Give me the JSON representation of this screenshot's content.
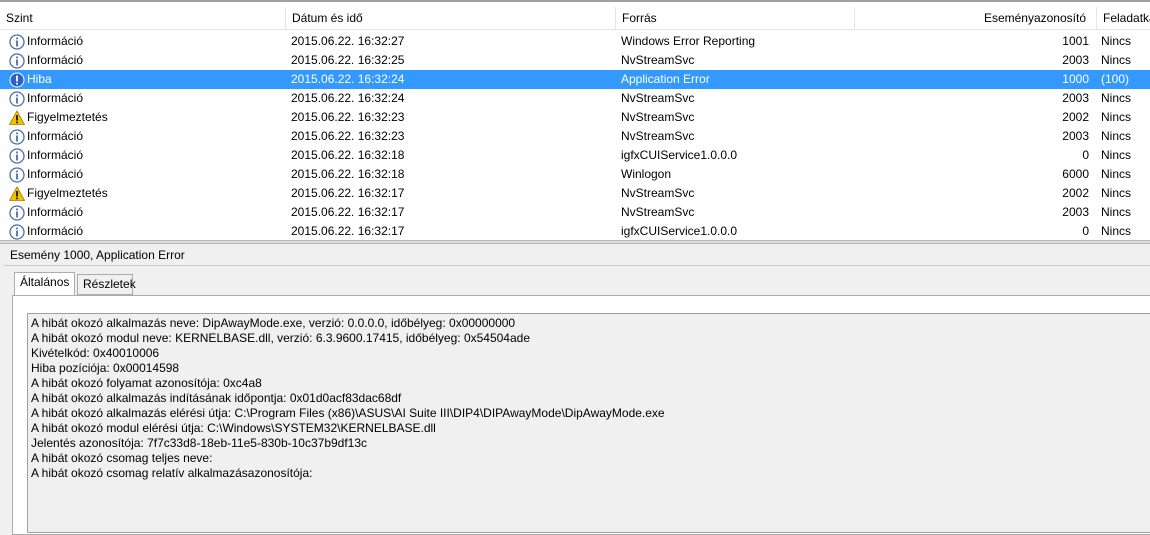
{
  "columns": {
    "level": "Szint",
    "date": "Dátum és idő",
    "source": "Forrás",
    "event_id": "Eseményazonosító",
    "task": "Feladatka"
  },
  "rows": [
    {
      "level": "Információ",
      "level_icon": "info-icon",
      "date": "2015.06.22. 16:32:27",
      "source": "Windows Error Reporting",
      "event_id": "1001",
      "task": "Nincs",
      "selected": false
    },
    {
      "level": "Információ",
      "level_icon": "info-icon",
      "date": "2015.06.22. 16:32:25",
      "source": "NvStreamSvc",
      "event_id": "2003",
      "task": "Nincs",
      "selected": false
    },
    {
      "level": "Hiba",
      "level_icon": "error-icon",
      "date": "2015.06.22. 16:32:24",
      "source": "Application Error",
      "event_id": "1000",
      "task": "(100)",
      "selected": true
    },
    {
      "level": "Információ",
      "level_icon": "info-icon",
      "date": "2015.06.22. 16:32:24",
      "source": "NvStreamSvc",
      "event_id": "2003",
      "task": "Nincs",
      "selected": false
    },
    {
      "level": "Figyelmeztetés",
      "level_icon": "warning-icon",
      "date": "2015.06.22. 16:32:23",
      "source": "NvStreamSvc",
      "event_id": "2002",
      "task": "Nincs",
      "selected": false
    },
    {
      "level": "Információ",
      "level_icon": "info-icon",
      "date": "2015.06.22. 16:32:23",
      "source": "NvStreamSvc",
      "event_id": "2003",
      "task": "Nincs",
      "selected": false
    },
    {
      "level": "Információ",
      "level_icon": "info-icon",
      "date": "2015.06.22. 16:32:18",
      "source": "igfxCUIService1.0.0.0",
      "event_id": "0",
      "task": "Nincs",
      "selected": false
    },
    {
      "level": "Információ",
      "level_icon": "info-icon",
      "date": "2015.06.22. 16:32:18",
      "source": "Winlogon",
      "event_id": "6000",
      "task": "Nincs",
      "selected": false
    },
    {
      "level": "Figyelmeztetés",
      "level_icon": "warning-icon",
      "date": "2015.06.22. 16:32:17",
      "source": "NvStreamSvc",
      "event_id": "2002",
      "task": "Nincs",
      "selected": false
    },
    {
      "level": "Információ",
      "level_icon": "info-icon",
      "date": "2015.06.22. 16:32:17",
      "source": "NvStreamSvc",
      "event_id": "2003",
      "task": "Nincs",
      "selected": false
    },
    {
      "level": "Információ",
      "level_icon": "info-icon",
      "date": "2015.06.22. 16:32:17",
      "source": "igfxCUIService1.0.0.0",
      "event_id": "0",
      "task": "Nincs",
      "selected": false
    }
  ],
  "detail": {
    "title": "Esemény 1000, Application Error",
    "tabs": {
      "general": "Általános",
      "details": "Részletek"
    },
    "lines": [
      "A hibát okozó alkalmazás neve: DipAwayMode.exe, verzió: 0.0.0.0, időbélyeg: 0x00000000",
      "A hibát okozó modul neve: KERNELBASE.dll, verzió: 6.3.9600.17415, időbélyeg: 0x54504ade",
      "Kivételkód: 0x40010006",
      "Hiba pozíciója: 0x00014598",
      "A hibát okozó folyamat azonosítója: 0xc4a8",
      "A hibát okozó alkalmazás indításának időpontja: 0x01d0acf83dac68df",
      "A hibát okozó alkalmazás elérési útja: C:\\Program Files (x86)\\ASUS\\AI Suite III\\DIP4\\DIPAwayMode\\DipAwayMode.exe",
      "A hibát okozó modul elérési útja: C:\\Windows\\SYSTEM32\\KERNELBASE.dll",
      "Jelentés azonosítója: 7f7c33d8-18eb-11e5-830b-10c37b9df13c",
      "A hibát okozó csomag teljes neve:",
      "A hibát okozó csomag relatív alkalmazásazonosítója:"
    ]
  },
  "colors": {
    "selection": "#3399ff",
    "info": "#4a6fa5",
    "error": "#2a63c8",
    "warning": "#f2c200"
  }
}
